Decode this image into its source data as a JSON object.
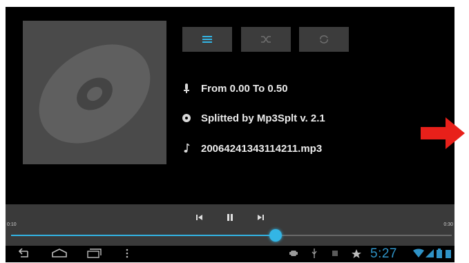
{
  "mode_buttons": {
    "playlist_icon": "playlist-icon",
    "shuffle_icon": "shuffle-icon",
    "repeat_icon": "repeat-icon",
    "active_color": "#33b5e5",
    "inactive_color": "#6f6f6f"
  },
  "track_info": {
    "comment": "From 0.00 To 0.50",
    "album": "Splitted by Mp3Splt v. 2.1",
    "filename": "20064241343114211.mp3"
  },
  "player": {
    "elapsed": "0:10",
    "duration": "0:30",
    "progress_fraction": 0.6,
    "accent_color": "#33b5e5"
  },
  "system_bar": {
    "time": "5:27"
  }
}
